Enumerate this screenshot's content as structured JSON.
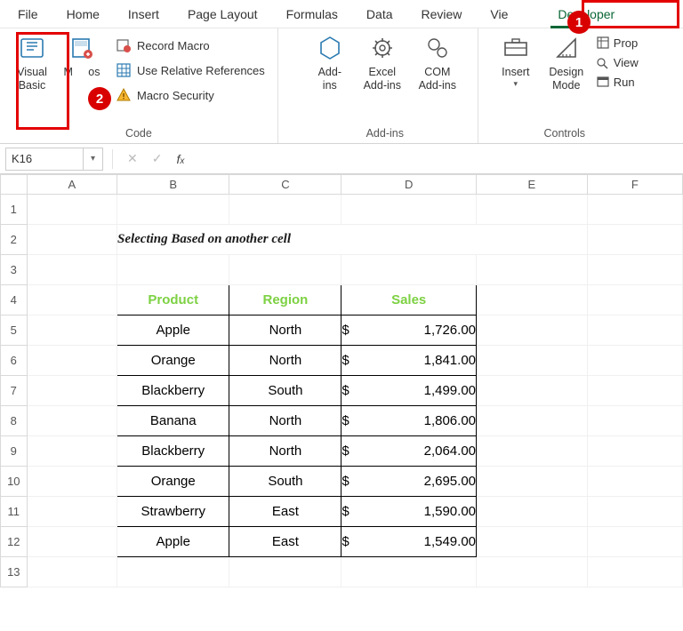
{
  "tabs": {
    "file": "File",
    "home": "Home",
    "insert": "Insert",
    "page_layout": "Page Layout",
    "formulas": "Formulas",
    "data": "Data",
    "review": "Review",
    "view": "Vie",
    "developer": "Developer"
  },
  "ribbon": {
    "code": {
      "visual_basic": "Visual\nBasic",
      "macros": "M",
      "macros_suffix": "os",
      "record_macro": "Record Macro",
      "use_relative": "Use Relative References",
      "macro_security": "Macro Security",
      "group": "Code"
    },
    "addins": {
      "addins": "Add-\nins",
      "excel_addins": "Excel\nAdd-ins",
      "com_addins": "COM\nAdd-ins",
      "group": "Add-ins"
    },
    "controls": {
      "insert": "Insert",
      "design_mode": "Design\nMode",
      "properties": "Prop",
      "view_code": "View",
      "run_dialog": "Run",
      "group": "Controls"
    }
  },
  "formula_bar": {
    "name_box": "K16"
  },
  "columns": [
    "A",
    "B",
    "C",
    "D",
    "E",
    "F"
  ],
  "rows": [
    1,
    2,
    3,
    4,
    5,
    6,
    7,
    8,
    9,
    10,
    11,
    12,
    13
  ],
  "title": "Selecting Based on another cell",
  "table": {
    "headers": {
      "product": "Product",
      "region": "Region",
      "sales": "Sales"
    },
    "rows": [
      {
        "product": "Apple",
        "region": "North",
        "sales": "1,726.00"
      },
      {
        "product": "Orange",
        "region": "North",
        "sales": "1,841.00"
      },
      {
        "product": "Blackberry",
        "region": "South",
        "sales": "1,499.00"
      },
      {
        "product": "Banana",
        "region": "North",
        "sales": "1,806.00"
      },
      {
        "product": "Blackberry",
        "region": "North",
        "sales": "2,064.00"
      },
      {
        "product": "Orange",
        "region": "South",
        "sales": "2,695.00"
      },
      {
        "product": "Strawberry",
        "region": "East",
        "sales": "1,590.00"
      },
      {
        "product": "Apple",
        "region": "East",
        "sales": "1,549.00"
      }
    ]
  },
  "badges": {
    "one": "1",
    "two": "2"
  }
}
